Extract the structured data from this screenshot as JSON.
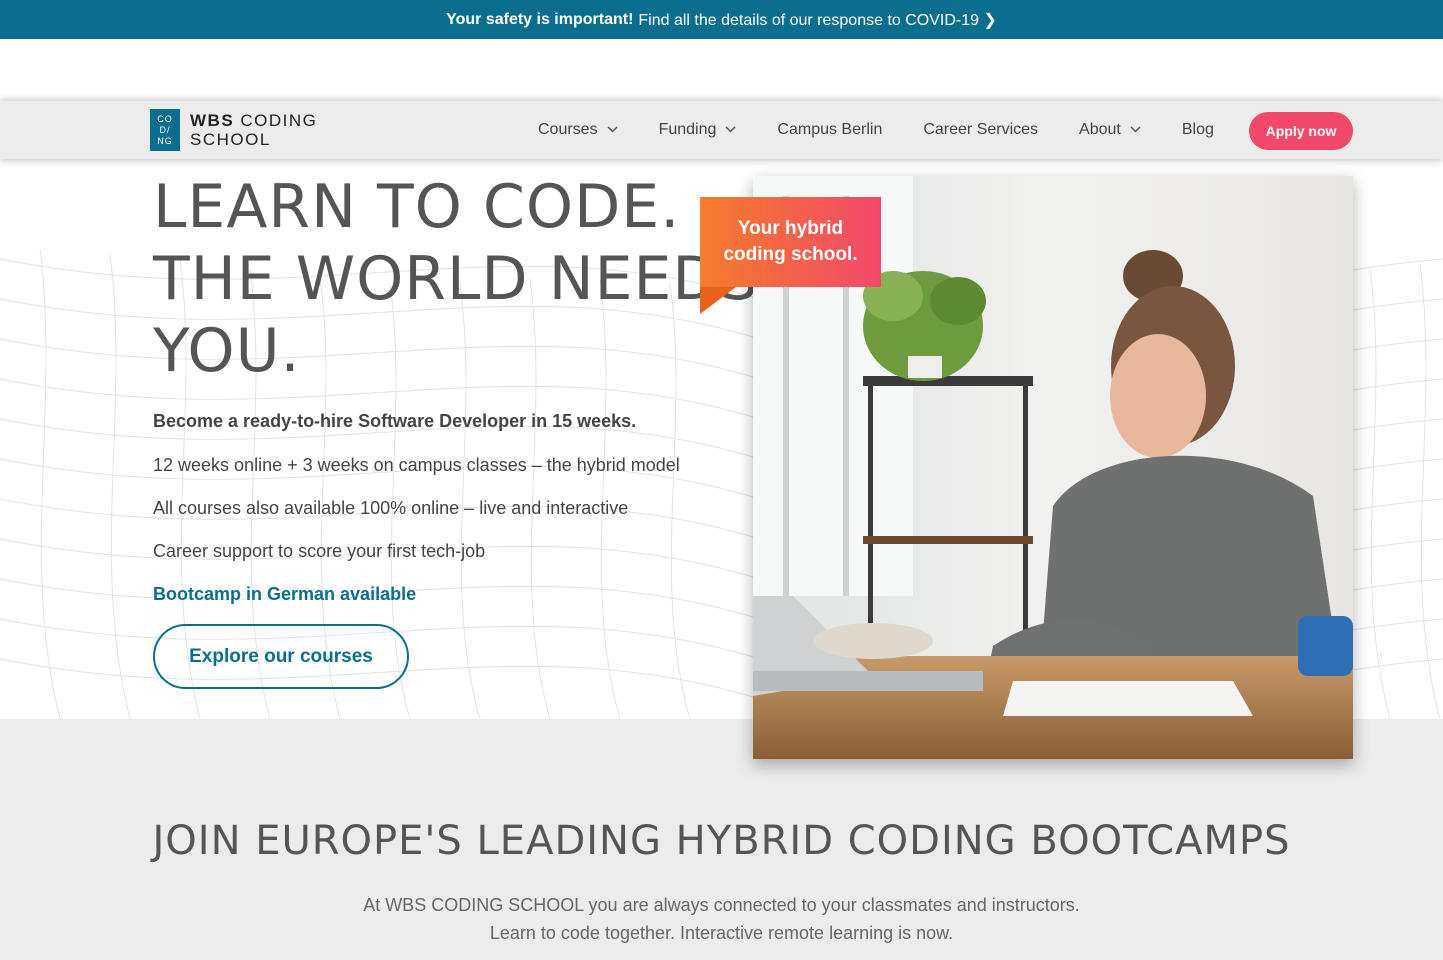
{
  "topbar": {
    "bold": "Your safety is important!",
    "text": "Find all the details of our response to COVID-19 ❯"
  },
  "logo": {
    "mark_lines": [
      "CO",
      "D/",
      "NG"
    ],
    "line1_bold": "WBS",
    "line1_rest": " CODING",
    "line2": "SCHOOL"
  },
  "nav": {
    "items": [
      {
        "label": "Courses",
        "dropdown": true
      },
      {
        "label": "Funding",
        "dropdown": true
      },
      {
        "label": "Campus Berlin",
        "dropdown": false
      },
      {
        "label": "Career Services",
        "dropdown": false
      },
      {
        "label": "About",
        "dropdown": true
      },
      {
        "label": "Blog",
        "dropdown": false
      }
    ],
    "apply": "Apply now"
  },
  "hero": {
    "headline": [
      "LEARN TO CODE.",
      "THE WORLD NEEDS",
      "YOU."
    ],
    "subtitle": "Become a ready-to-hire Software Developer in 15 weeks.",
    "lines": [
      "12 weeks online + 3 weeks on campus classes – the hybrid model",
      "All courses also available 100% online – live and interactive",
      "Career support to score your first tech-job"
    ],
    "german_link": "Bootcamp in German available",
    "cta": "Explore our courses",
    "ribbon": [
      "Your hybrid",
      "coding school."
    ],
    "photo_alt": "woman-working-on-laptop-image"
  },
  "section2": {
    "title": "JOIN EUROPE'S LEADING HYBRID CODING BOOTCAMPS",
    "text": [
      "At WBS CODING SCHOOL you are always connected to your classmates and instructors.",
      "Learn to code together. Interactive remote learning is now."
    ]
  },
  "colors": {
    "brand": "#0b6e8f",
    "accent": "#f2486a",
    "ribbon_start": "#f57c2b"
  }
}
